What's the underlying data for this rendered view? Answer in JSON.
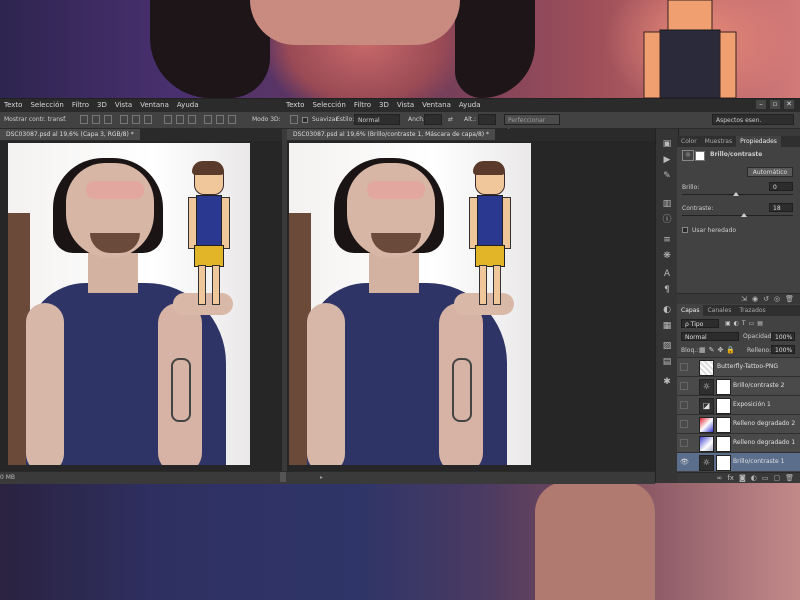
{
  "menu_left": [
    "Texto",
    "Selección",
    "Filtro",
    "3D",
    "Vista",
    "Ventana",
    "Ayuda"
  ],
  "menu_right": [
    "Texto",
    "Selección",
    "Filtro",
    "3D",
    "Vista",
    "Ventana",
    "Ayuda"
  ],
  "options": {
    "transform_label": "Mostrar contr. transf.",
    "mode3d_label": "Modo 3D:",
    "smooth_label": "Suavizar",
    "style_label": "Estilo:",
    "style_value": "Normal",
    "width_label": "Anch.:",
    "height_label": "Alt.:",
    "refine_button": "Perfeccionar bor...",
    "workspace": "Aspectos esen."
  },
  "documents": [
    {
      "tab": "DSC03087.psd al 19,6% (Capa 3, RGB/8) *"
    },
    {
      "tab": "DSC03087.psd al 19,6% (Brillo/contraste 1, Máscara de capa/8) *"
    }
  ],
  "status": {
    "size": "0 MB"
  },
  "properties": {
    "tabs": [
      "Color",
      "Muestras",
      "Propiedades"
    ],
    "active_tab": "Propiedades",
    "title": "Brillo/contraste",
    "auto_button": "Automático",
    "brightness_label": "Brillo:",
    "brightness_value": "0",
    "contrast_label": "Contraste:",
    "contrast_value": "18",
    "legacy_label": "Usar heredado"
  },
  "layers": {
    "tabs": [
      "Capas",
      "Canales",
      "Trazados"
    ],
    "filter_value": "Tipo",
    "blend_mode": "Normal",
    "opacity_label": "Opacidad:",
    "opacity_value": "100%",
    "lock_label": "Bloq.:",
    "fill_label": "Relleno:",
    "fill_value": "100%",
    "items": [
      {
        "name": "Butterfly-Tattoo-PNG",
        "visible": false,
        "icon": "image",
        "selected": false
      },
      {
        "name": "Brillo/contraste 2",
        "visible": false,
        "icon": "sun",
        "selected": false
      },
      {
        "name": "Exposición 1",
        "visible": false,
        "icon": "exposure",
        "selected": false
      },
      {
        "name": "Relleno degradado 2",
        "visible": false,
        "icon": "gradient",
        "selected": false
      },
      {
        "name": "Relleno degradado 1",
        "visible": false,
        "icon": "gradient",
        "selected": false
      },
      {
        "name": "Brillo/contraste 1",
        "visible": true,
        "icon": "sun",
        "selected": true
      }
    ]
  }
}
